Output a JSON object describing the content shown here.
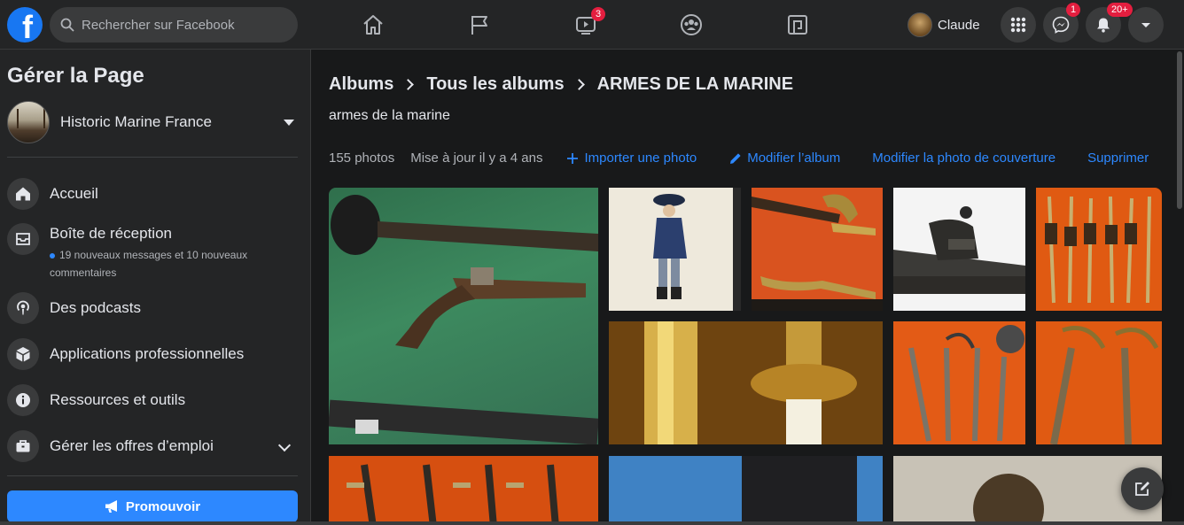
{
  "topbar": {
    "search_placeholder": "Rechercher sur Facebook",
    "watch_badge": "3",
    "profile_name": "Claude",
    "messenger_badge": "1",
    "notifications_badge": "20+"
  },
  "sidebar": {
    "title": "Gérer la Page",
    "page_name": "Historic Marine France",
    "items": [
      {
        "label": "Accueil",
        "icon": "home-icon"
      },
      {
        "label": "Boîte de réception",
        "icon": "inbox-icon",
        "sub": "19 nouveaux messages et 10 nouveaux commentaires"
      },
      {
        "label": "Des podcasts",
        "icon": "podcast-icon"
      },
      {
        "label": "Applications professionnelles",
        "icon": "cube-icon"
      },
      {
        "label": "Ressources et outils",
        "icon": "info-icon"
      },
      {
        "label": "Gérer les offres d’emploi",
        "icon": "briefcase-icon"
      }
    ],
    "promote_label": "Promouvoir"
  },
  "main": {
    "breadcrumb": [
      "Albums",
      "Tous les albums",
      "ARMES DE LA MARINE"
    ],
    "description": "armes de la marine",
    "photo_count": "155 photos",
    "updated": "Mise à jour il y a 4 ans",
    "actions": {
      "import": "Importer une photo",
      "edit": "Modifier l’album",
      "cover": "Modifier la photo de couverture",
      "delete": "Supprimer"
    }
  },
  "colors": {
    "accent": "#2d88ff",
    "badge": "#e41e3f",
    "background": "#18191a",
    "surface": "#242526"
  }
}
